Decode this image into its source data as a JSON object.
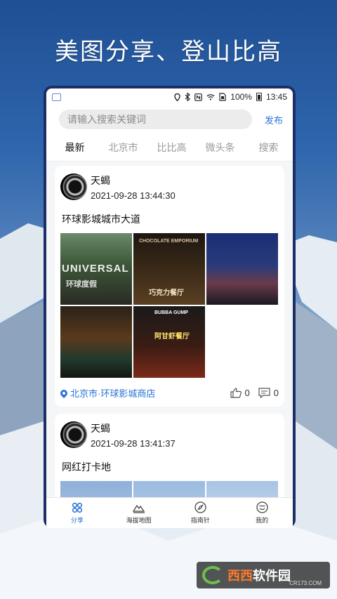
{
  "headline": "美图分享、登山比高",
  "status_bar": {
    "battery": "100%",
    "time": "13:45"
  },
  "search": {
    "placeholder": "请输入搜索关键词",
    "publish_label": "发布"
  },
  "tabs": [
    {
      "label": "最新",
      "active": true
    },
    {
      "label": "北京市",
      "active": false
    },
    {
      "label": "比比高",
      "active": false
    },
    {
      "label": "微头条",
      "active": false
    },
    {
      "label": "搜索",
      "active": false
    }
  ],
  "posts": [
    {
      "author": "天蝎",
      "time": "2021-09-28 13:44:30",
      "title": "环球影城城市大道",
      "photo_captions": [
        "UNIVERSAL",
        "环球度假",
        "巧克力餐厅",
        "CHOCOLATE EMPORIUM",
        "BUBBA GUMP",
        "阿甘虾餐厅"
      ],
      "location": "北京市·环球影城商店",
      "likes": "0",
      "comments": "0"
    },
    {
      "author": "天蝎",
      "time": "2021-09-28 13:41:37",
      "title": "网红打卡地"
    }
  ],
  "bottom_nav": [
    {
      "label": "分享",
      "icon": "share-icon",
      "active": true
    },
    {
      "label": "海拔地图",
      "icon": "mountain-map-icon",
      "active": false
    },
    {
      "label": "指南针",
      "icon": "compass-icon",
      "active": false
    },
    {
      "label": "我的",
      "icon": "profile-icon",
      "active": false
    }
  ],
  "watermark": {
    "brand": "西西",
    "suffix": "软件园",
    "url": "CR173.COM"
  },
  "colors": {
    "accent": "#2a74d6",
    "phone_frame": "#1b2f66"
  }
}
